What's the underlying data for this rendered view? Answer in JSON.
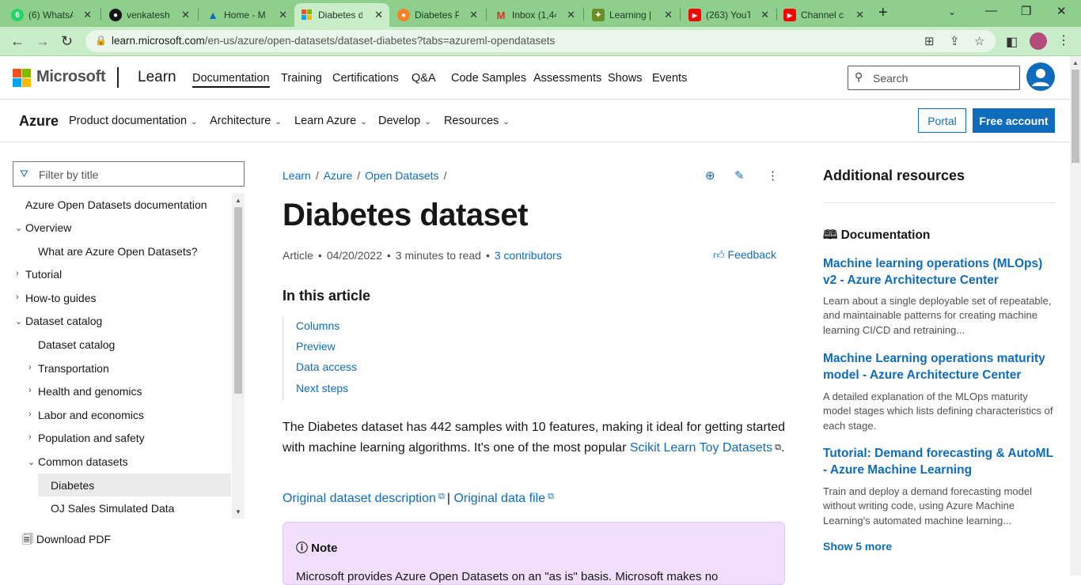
{
  "browser": {
    "tabs": [
      {
        "label": "(6) WhatsA",
        "icon": "whatsapp-icon",
        "color": "#25d366"
      },
      {
        "label": "venkatesh",
        "icon": "github-icon",
        "color": "#171717"
      },
      {
        "label": "Home - M",
        "icon": "azure-icon",
        "color": "#0f6cbd"
      },
      {
        "label": "Diabetes d",
        "icon": "microsoft-icon",
        "color": "#f25022"
      },
      {
        "label": "Diabetes P",
        "icon": "kaggle-icon",
        "color": "#f58025"
      },
      {
        "label": "Inbox (1,44",
        "icon": "gmail-icon",
        "color": "#d93025"
      },
      {
        "label": "Learning |",
        "icon": "learning-icon",
        "color": "#6b8e23"
      },
      {
        "label": "(263) YouT",
        "icon": "youtube-icon",
        "color": "#ff0000"
      },
      {
        "label": "Channel c",
        "icon": "youtube-icon",
        "color": "#ff0000"
      }
    ],
    "url_host": "learn.microsoft.com",
    "url_path": "/en-us/azure/open-datasets/dataset-diabetes?tabs=azureml-opendatasets"
  },
  "header": {
    "brand": "Microsoft",
    "learn": "Learn",
    "nav": [
      "Documentation",
      "Training",
      "Certifications",
      "Q&A",
      "Code Samples",
      "Assessments",
      "Shows",
      "Events"
    ],
    "search_placeholder": "Search"
  },
  "azure_bar": {
    "title": "Azure",
    "nav": [
      "Product documentation",
      "Architecture",
      "Learn Azure",
      "Develop",
      "Resources"
    ],
    "portal": "Portal",
    "free_account": "Free account"
  },
  "sidebar": {
    "filter_placeholder": "Filter by title",
    "items": [
      "Azure Open Datasets documentation",
      "Overview",
      "What are Azure Open Datasets?",
      "Tutorial",
      "How-to guides",
      "Dataset catalog",
      "Dataset catalog",
      "Transportation",
      "Health and genomics",
      "Labor and economics",
      "Population and safety",
      "Common datasets",
      "Diabetes",
      "OJ Sales Simulated Data"
    ],
    "download_pdf": "Download PDF"
  },
  "article": {
    "breadcrumb": [
      "Learn",
      "Azure",
      "Open Datasets"
    ],
    "title": "Diabetes dataset",
    "meta_type": "Article",
    "meta_date": "04/20/2022",
    "meta_read": "3 minutes to read",
    "meta_contributors": "3 contributors",
    "feedback": "Feedback",
    "in_this_article": "In this article",
    "sections": [
      "Columns",
      "Preview",
      "Data access",
      "Next steps"
    ],
    "intro_text": "The Diabetes dataset has 442 samples with 10 features, making it ideal for getting started with machine learning algorithms. It's one of the most popular ",
    "intro_link": "Scikit Learn Toy Datasets",
    "intro_end": ".",
    "link_desc": "Original dataset description",
    "link_sep": "|",
    "link_file": "Original data file",
    "note_title": "Note",
    "note_text": "Microsoft provides Azure Open Datasets on an \"as is\" basis. Microsoft makes no"
  },
  "resources": {
    "title": "Additional resources",
    "section": "Documentation",
    "items": [
      {
        "title": "Machine learning operations (MLOps) v2 - Azure Architecture Center",
        "desc": "Learn about a single deployable set of repeatable, and maintainable patterns for creating machine learning CI/CD and retraining..."
      },
      {
        "title": "Machine Learning operations maturity model - Azure Architecture Center",
        "desc": "A detailed explanation of the MLOps maturity model stages which lists defining characteristics of each stage."
      },
      {
        "title": "Tutorial: Demand forecasting & AutoML - Azure Machine Learning",
        "desc": "Train and deploy a demand forecasting model without writing code, using Azure Machine Learning's automated machine learning..."
      }
    ],
    "show_more": "Show 5 more"
  },
  "colors": {
    "accent": "#0f6cbd",
    "note_bg": "#f2deff",
    "browser_frame": "#8ecf8e"
  }
}
